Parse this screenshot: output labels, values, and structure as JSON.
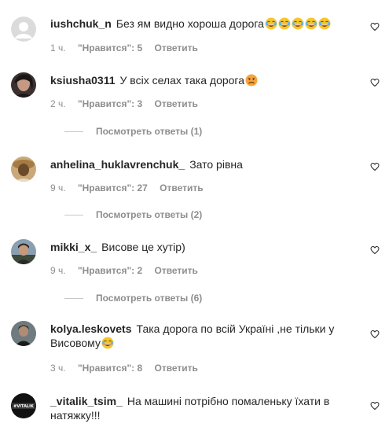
{
  "comments": [
    {
      "username": "iushchuk_n",
      "text": "Без ям видно хороша дорога",
      "emojis": [
        "grin-sweat",
        "grin-sweat",
        "grin-sweat",
        "grin-sweat",
        "grin-sweat"
      ],
      "time": "1 ч.",
      "likes_label": "\"Нравится\": 5",
      "reply_label": "Ответить",
      "avatar_icon": "default-avatar-icon"
    },
    {
      "username": "ksiusha0311",
      "text": "У всіх селах така дорога",
      "emojis": [
        "sad"
      ],
      "time": "2 ч.",
      "likes_label": "\"Нравится\": 3",
      "reply_label": "Ответить",
      "view_replies": "Посмотреть ответы (1)"
    },
    {
      "username": "anhelina_huklavrenchuk_",
      "text": "Зато рівна",
      "emojis": [],
      "time": "9 ч.",
      "likes_label": "\"Нравится\": 27",
      "reply_label": "Ответить",
      "view_replies": "Посмотреть ответы (2)"
    },
    {
      "username": "mikki_x_",
      "text": "Висове це хутір)",
      "emojis": [],
      "time": "9 ч.",
      "likes_label": "\"Нравится\": 2",
      "reply_label": "Ответить",
      "view_replies": "Посмотреть ответы (6)"
    },
    {
      "username": "kolya.leskovets",
      "text": "Така дорога по всій Україні ,не тільки у Висовому",
      "emojis": [
        "grin-sweat"
      ],
      "time": "3 ч.",
      "likes_label": "\"Нравится\": 8",
      "reply_label": "Ответить"
    },
    {
      "username": "_vitalik_tsim_",
      "text": "На машині потрібно помаленьку їхати в натяжку!!!",
      "emojis": [],
      "avatar_text": "#VITALIK"
    }
  ],
  "colors": {
    "text": "#262626",
    "meta": "#8e8e8e",
    "divider": "#c7c7c7"
  }
}
